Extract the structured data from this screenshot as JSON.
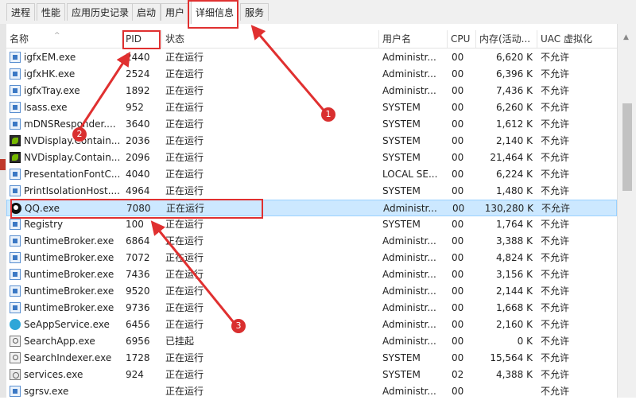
{
  "tabs": [
    "进程",
    "性能",
    "应用历史记录",
    "启动",
    "用户",
    "详细信息",
    "服务"
  ],
  "columns": {
    "name": "名称",
    "pid": "PID",
    "status": "状态",
    "user": "用户名",
    "cpu": "CPU",
    "memory": "内存(活动...",
    "uac": "UAC 虚拟化"
  },
  "rows": [
    {
      "icon": "app",
      "name": "igfxEM.exe",
      "pid": "2440",
      "status": "正在运行",
      "user": "Administr...",
      "cpu": "00",
      "mem": "6,620 K",
      "uac": "不允许"
    },
    {
      "icon": "app",
      "name": "igfxHK.exe",
      "pid": "2524",
      "status": "正在运行",
      "user": "Administr...",
      "cpu": "00",
      "mem": "6,396 K",
      "uac": "不允许"
    },
    {
      "icon": "app",
      "name": "igfxTray.exe",
      "pid": "1892",
      "status": "正在运行",
      "user": "Administr...",
      "cpu": "00",
      "mem": "7,436 K",
      "uac": "不允许"
    },
    {
      "icon": "app",
      "name": "lsass.exe",
      "pid": "952",
      "status": "正在运行",
      "user": "SYSTEM",
      "cpu": "00",
      "mem": "6,260 K",
      "uac": "不允许"
    },
    {
      "icon": "app",
      "name": "mDNSResponder....",
      "pid": "3640",
      "status": "正在运行",
      "user": "SYSTEM",
      "cpu": "00",
      "mem": "1,612 K",
      "uac": "不允许"
    },
    {
      "icon": "nv",
      "name": "NVDisplay.Contain...",
      "pid": "2036",
      "status": "正在运行",
      "user": "SYSTEM",
      "cpu": "00",
      "mem": "2,140 K",
      "uac": "不允许"
    },
    {
      "icon": "nv",
      "name": "NVDisplay.Contain...",
      "pid": "2096",
      "status": "正在运行",
      "user": "SYSTEM",
      "cpu": "00",
      "mem": "21,464 K",
      "uac": "不允许"
    },
    {
      "icon": "app",
      "name": "PresentationFontC...",
      "pid": "4040",
      "status": "正在运行",
      "user": "LOCAL SE...",
      "cpu": "00",
      "mem": "6,224 K",
      "uac": "不允许"
    },
    {
      "icon": "app",
      "name": "PrintIsolationHost....",
      "pid": "4964",
      "status": "正在运行",
      "user": "SYSTEM",
      "cpu": "00",
      "mem": "1,480 K",
      "uac": "不允许"
    },
    {
      "icon": "qq",
      "name": "QQ.exe",
      "pid": "7080",
      "status": "正在运行",
      "user": "Administr...",
      "cpu": "00",
      "mem": "130,280 K",
      "uac": "不允许",
      "selected": true
    },
    {
      "icon": "app",
      "name": "Registry",
      "pid": "100",
      "status": "正在运行",
      "user": "SYSTEM",
      "cpu": "00",
      "mem": "1,764 K",
      "uac": "不允许"
    },
    {
      "icon": "app",
      "name": "RuntimeBroker.exe",
      "pid": "6864",
      "status": "正在运行",
      "user": "Administr...",
      "cpu": "00",
      "mem": "3,388 K",
      "uac": "不允许"
    },
    {
      "icon": "app",
      "name": "RuntimeBroker.exe",
      "pid": "7072",
      "status": "正在运行",
      "user": "Administr...",
      "cpu": "00",
      "mem": "4,824 K",
      "uac": "不允许"
    },
    {
      "icon": "app",
      "name": "RuntimeBroker.exe",
      "pid": "7436",
      "status": "正在运行",
      "user": "Administr...",
      "cpu": "00",
      "mem": "3,156 K",
      "uac": "不允许"
    },
    {
      "icon": "app",
      "name": "RuntimeBroker.exe",
      "pid": "9520",
      "status": "正在运行",
      "user": "Administr...",
      "cpu": "00",
      "mem": "2,144 K",
      "uac": "不允许"
    },
    {
      "icon": "app",
      "name": "RuntimeBroker.exe",
      "pid": "9736",
      "status": "正在运行",
      "user": "Administr...",
      "cpu": "00",
      "mem": "1,668 K",
      "uac": "不允许"
    },
    {
      "icon": "se",
      "name": "SeAppService.exe",
      "pid": "6456",
      "status": "正在运行",
      "user": "Administr...",
      "cpu": "00",
      "mem": "2,160 K",
      "uac": "不允许"
    },
    {
      "icon": "search",
      "name": "SearchApp.exe",
      "pid": "6956",
      "status": "已挂起",
      "user": "Administr...",
      "cpu": "00",
      "mem": "0 K",
      "uac": "不允许"
    },
    {
      "icon": "search",
      "name": "SearchIndexer.exe",
      "pid": "1728",
      "status": "正在运行",
      "user": "SYSTEM",
      "cpu": "00",
      "mem": "15,564 K",
      "uac": "不允许"
    },
    {
      "icon": "svc",
      "name": "services.exe",
      "pid": "924",
      "status": "正在运行",
      "user": "SYSTEM",
      "cpu": "02",
      "mem": "4,388 K",
      "uac": "不允许"
    },
    {
      "icon": "app",
      "name": "sgrsv.exe",
      "pid": "",
      "status": "正在运行",
      "user": "Administr...",
      "cpu": "00",
      "mem": "",
      "uac": "不允许"
    }
  ],
  "annotations": [
    "1",
    "2",
    "3"
  ],
  "colors": {
    "annotation": "#e03030",
    "selected_row": "#cce8ff"
  }
}
